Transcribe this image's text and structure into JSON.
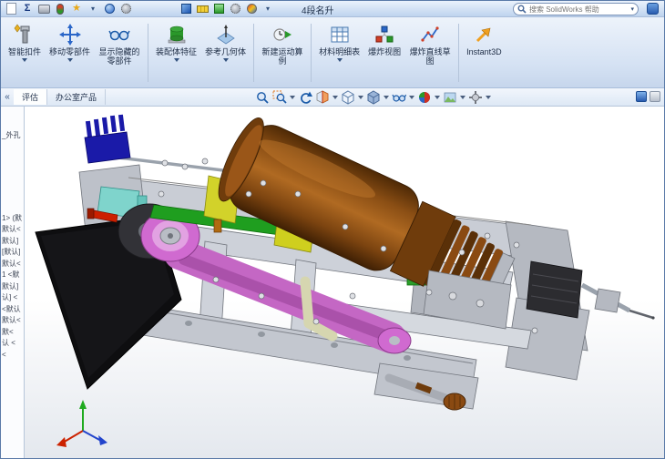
{
  "window": {
    "title": "4段名升"
  },
  "menubar": {
    "search_placeholder": "搜索 SolidWorks 帮助",
    "left_icons": [
      "new-document",
      "sigma",
      "print",
      "rebuild",
      "favorites",
      "dropdown",
      "sphere",
      "options"
    ],
    "mid_icons": [
      "cube",
      "measure",
      "chart",
      "gear",
      "palette",
      "dropdown"
    ]
  },
  "ribbon": {
    "buttons": [
      {
        "label": "智能扣件",
        "dropdown": true
      },
      {
        "label": "移动零部件",
        "dropdown": true
      },
      {
        "label": "显示隐藏的零部件",
        "dropdown": false
      },
      {
        "label": "装配体特征",
        "dropdown": true
      },
      {
        "label": "参考几何体",
        "dropdown": true
      },
      {
        "label": "新建运动算例",
        "dropdown": false
      },
      {
        "label": "材料明细表",
        "dropdown": true
      },
      {
        "label": "爆炸视图",
        "dropdown": false
      },
      {
        "label": "爆炸直线草图",
        "dropdown": false
      },
      {
        "label": "Instant3D",
        "dropdown": false
      }
    ]
  },
  "tabstrip": {
    "collapse_glyph": "«",
    "tabs": [
      {
        "label": "评估"
      },
      {
        "label": "办公室产品"
      }
    ]
  },
  "view_toolbar": {
    "icons": [
      "zoom-to-fit",
      "zoom-to-area",
      "previous-view",
      "section-view",
      "view-orientation",
      "display-style",
      "hide-show-items",
      "edit-appearance",
      "apply-scene",
      "view-settings"
    ]
  },
  "feature_tree": {
    "items": [
      "_外孔",
      "1> (默",
      "默认<",
      "默认]",
      "[默认]",
      "默认<",
      "1 <默",
      "默认]",
      "认] <",
      "<默认",
      "默认<",
      "默<",
      "认 <",
      "<"
    ]
  },
  "model": {
    "parts": [
      "base-frame",
      "drive-cylinder",
      "belt",
      "pulley",
      "idler-roller",
      "green-plate",
      "yellow-brackets",
      "blue-comb-bracket",
      "teal-block",
      "black-plate",
      "red-screw",
      "right-motor",
      "hand-knob"
    ],
    "colors": {
      "frame": "#c6cad2",
      "cylinder": "#8a4a12",
      "belt": "#c467c4",
      "pulley": "#d06ad0",
      "green_plate": "#1f9e1f",
      "yellow_bracket": "#d2d22a",
      "comb_blue": "#1a1aa8",
      "teal_block": "#7fd4cc",
      "black_plate": "#0e0e10",
      "red_screw": "#cc2000",
      "motor_dark": "#2c2c30",
      "triad_x": "#cc2200",
      "triad_y": "#1faa1f",
      "triad_z": "#2244cc"
    }
  }
}
